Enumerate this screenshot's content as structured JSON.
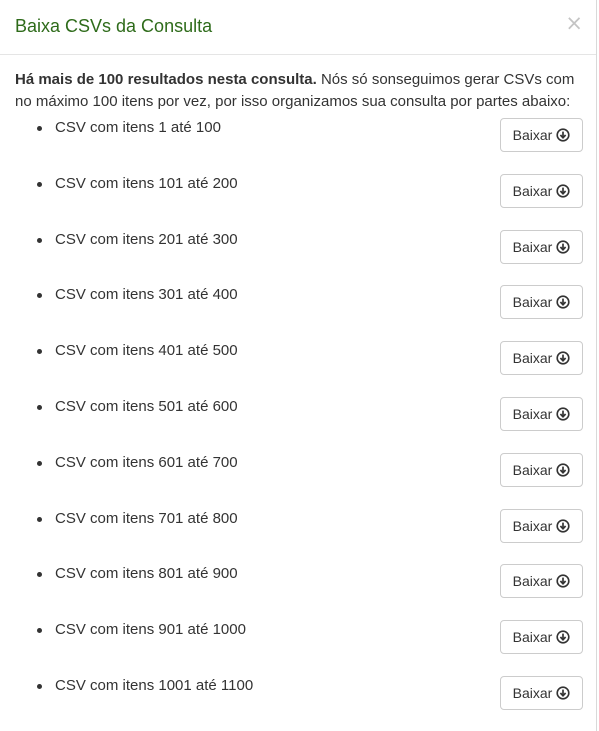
{
  "modal": {
    "title": "Baixa CSVs da Consulta",
    "close_symbol": "×",
    "intro_bold": "Há mais de 100 resultados nesta consulta.",
    "intro_text": " Nós só sonseguimos gerar CSVs com no máximo 100 itens por vez, por isso organizamos sua consulta por partes abaixo:",
    "button_label": "Baixar",
    "button_icon": "download-circle-icon",
    "items": [
      {
        "label": "CSV com itens 1 até 100"
      },
      {
        "label": "CSV com itens 101 até 200"
      },
      {
        "label": "CSV com itens 201 até 300"
      },
      {
        "label": "CSV com itens 301 até 400"
      },
      {
        "label": "CSV com itens 401 até 500"
      },
      {
        "label": "CSV com itens 501 até 600"
      },
      {
        "label": "CSV com itens 601 até 700"
      },
      {
        "label": "CSV com itens 701 até 800"
      },
      {
        "label": "CSV com itens 801 até 900"
      },
      {
        "label": "CSV com itens 901 até 1000"
      },
      {
        "label": "CSV com itens 1001 até 1100"
      }
    ]
  },
  "colors": {
    "title": "#2e6b1a",
    "text": "#333333",
    "border": "#cccccc"
  }
}
